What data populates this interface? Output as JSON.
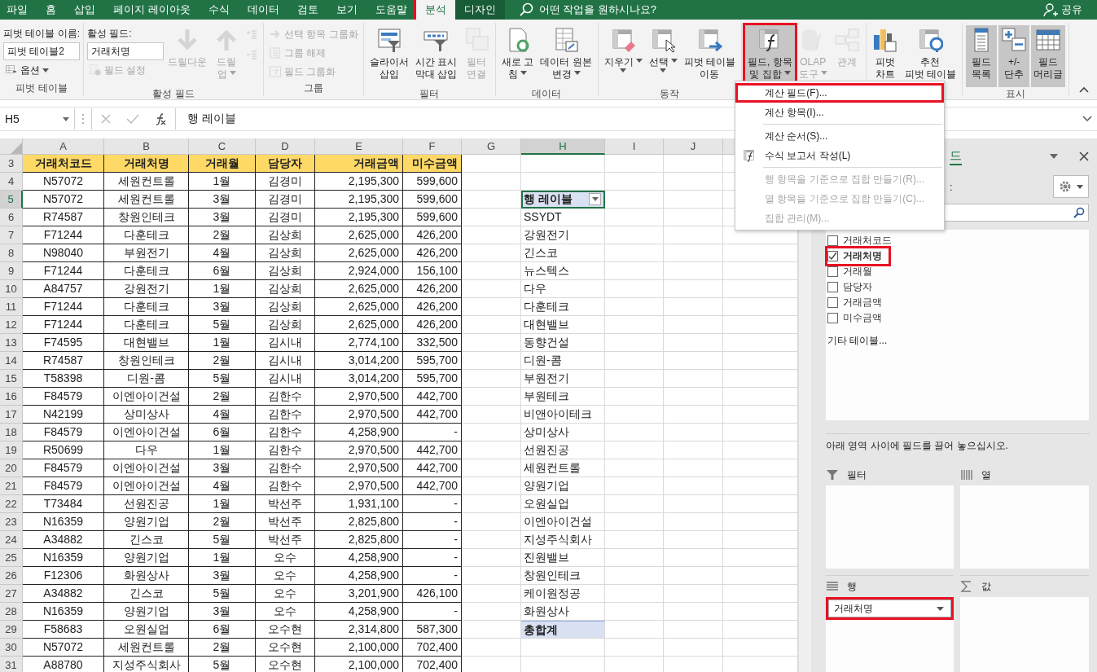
{
  "menu_tabs": [
    {
      "label": "파일",
      "selected": false,
      "kind": "normal",
      "highlighted": false
    },
    {
      "label": "홈",
      "selected": false,
      "kind": "normal",
      "highlighted": false
    },
    {
      "label": "삽입",
      "selected": false,
      "kind": "normal",
      "highlighted": false
    },
    {
      "label": "페이지 레이아웃",
      "selected": false,
      "kind": "normal",
      "highlighted": false
    },
    {
      "label": "수식",
      "selected": false,
      "kind": "normal",
      "highlighted": false
    },
    {
      "label": "데이터",
      "selected": false,
      "kind": "normal",
      "highlighted": false
    },
    {
      "label": "검토",
      "selected": false,
      "kind": "normal",
      "highlighted": false
    },
    {
      "label": "보기",
      "selected": false,
      "kind": "normal",
      "highlighted": false
    },
    {
      "label": "도움말",
      "selected": false,
      "kind": "normal",
      "highlighted": false
    },
    {
      "label": "분석",
      "selected": true,
      "kind": "contextual",
      "highlighted": true
    },
    {
      "label": "디자인",
      "selected": false,
      "kind": "contextual",
      "highlighted": false
    }
  ],
  "search": {
    "placeholder": "어떤 작업을 원하시나요?"
  },
  "share": "공유",
  "ribbon": {
    "groups": [
      {
        "label": "피벗 테이블",
        "columns": [
          [
            {
              "kind": "label",
              "text": "피벗 테이블 이름:"
            },
            {
              "kind": "field",
              "value": "피벗 테이블2"
            },
            {
              "kind": "small",
              "text": "옵션",
              "disabled": false,
              "has_menu": true
            }
          ]
        ]
      },
      {
        "label": "활성 필드",
        "columns": [
          [
            {
              "kind": "label",
              "text": "활성 필드:"
            },
            {
              "kind": "field",
              "value": "거래처명"
            },
            {
              "kind": "small",
              "text": "필드 설정",
              "disabled": true,
              "has_menu": false
            }
          ],
          [
            {
              "kind": "large",
              "lines": [
                "드릴다운"
              ],
              "disabled": true,
              "has_menu": false,
              "pressed": false,
              "highlighted": false
            }
          ],
          [
            {
              "kind": "large",
              "lines": [
                "드릴",
                "업"
              ],
              "disabled": true,
              "has_menu": true,
              "pressed": false,
              "highlighted": false
            }
          ],
          [
            {
              "kind": "icon",
              "disabled": true
            },
            {
              "kind": "icon",
              "disabled": true
            }
          ]
        ]
      },
      {
        "label": "그룹",
        "columns": [
          [
            {
              "kind": "small",
              "text": "선택 항목 그룹화",
              "disabled": true,
              "has_menu": false
            },
            {
              "kind": "small",
              "text": "그룹 해제",
              "disabled": true,
              "has_menu": false
            },
            {
              "kind": "small",
              "text": "필드 그룹화",
              "disabled": true,
              "has_menu": false
            }
          ]
        ]
      },
      {
        "label": "필터",
        "columns": [
          [
            {
              "kind": "large",
              "lines": [
                "슬라이서",
                "삽입"
              ],
              "disabled": false,
              "has_menu": false,
              "pressed": false,
              "highlighted": false
            }
          ],
          [
            {
              "kind": "large",
              "lines": [
                "시간 표시",
                "막대 삽입"
              ],
              "disabled": false,
              "has_menu": false,
              "pressed": false,
              "highlighted": false
            }
          ],
          [
            {
              "kind": "large",
              "lines": [
                "필터",
                "연결"
              ],
              "disabled": true,
              "has_menu": false,
              "pressed": false,
              "highlighted": false
            }
          ]
        ]
      },
      {
        "label": "데이터",
        "columns": [
          [
            {
              "kind": "large",
              "lines": [
                "새로 고",
                "침"
              ],
              "disabled": false,
              "has_menu": true,
              "pressed": false,
              "highlighted": false
            }
          ],
          [
            {
              "kind": "large",
              "lines": [
                "데이터 원본",
                "변경"
              ],
              "disabled": false,
              "has_menu": true,
              "pressed": false,
              "highlighted": false
            }
          ]
        ]
      },
      {
        "label": "동작",
        "columns": [
          [
            {
              "kind": "large",
              "lines": [
                "지우기"
              ],
              "disabled": false,
              "has_menu": true,
              "pressed": false,
              "highlighted": false
            }
          ],
          [
            {
              "kind": "large",
              "lines": [
                "선택"
              ],
              "disabled": false,
              "has_menu": true,
              "pressed": false,
              "highlighted": false
            }
          ],
          [
            {
              "kind": "large",
              "lines": [
                "피벗 테이블",
                "이동"
              ],
              "disabled": false,
              "has_menu": false,
              "pressed": false,
              "highlighted": false
            }
          ]
        ]
      },
      {
        "columns": [
          [
            {
              "kind": "large",
              "lines": [
                "필드, 항목",
                "및 집합"
              ],
              "disabled": false,
              "has_menu": true,
              "pressed": true,
              "highlighted": true
            }
          ],
          [
            {
              "kind": "large",
              "lines": [
                "OLAP",
                "도구"
              ],
              "disabled": true,
              "has_menu": true,
              "pressed": false,
              "highlighted": false
            }
          ],
          [
            {
              "kind": "large",
              "lines": [
                "관계"
              ],
              "disabled": true,
              "has_menu": false,
              "pressed": false,
              "highlighted": false
            }
          ]
        ]
      },
      {
        "columns": [
          [
            {
              "kind": "large",
              "lines": [
                "피벗",
                "차트"
              ],
              "disabled": false,
              "has_menu": false,
              "pressed": false,
              "highlighted": false
            }
          ],
          [
            {
              "kind": "large",
              "lines": [
                "추천",
                "피벗 테이블"
              ],
              "disabled": false,
              "has_menu": false,
              "pressed": false,
              "highlighted": false
            }
          ]
        ]
      },
      {
        "label": "표시",
        "columns": [
          [
            {
              "kind": "large",
              "lines": [
                "필드",
                "목록"
              ],
              "disabled": false,
              "has_menu": false,
              "pressed": true,
              "highlighted": false
            }
          ],
          [
            {
              "kind": "large",
              "lines": [
                "+/-",
                "단추"
              ],
              "disabled": false,
              "has_menu": false,
              "pressed": true,
              "highlighted": false
            }
          ],
          [
            {
              "kind": "large",
              "lines": [
                "필드",
                "머리글"
              ],
              "disabled": false,
              "has_menu": false,
              "pressed": true,
              "highlighted": false
            }
          ]
        ]
      }
    ]
  },
  "dropdown_menu": [
    {
      "kind": "item",
      "label": "계산 필드(F)...",
      "disabled": false,
      "has_icon": false,
      "highlighted": true
    },
    {
      "kind": "item",
      "label": "계산 항목(I)...",
      "disabled": false,
      "has_icon": false,
      "highlighted": false
    },
    {
      "kind": "separator"
    },
    {
      "kind": "item",
      "label": "계산 순서(S)...",
      "disabled": false,
      "has_icon": false,
      "highlighted": false
    },
    {
      "kind": "item",
      "label": "수식 보고서 작성(L)",
      "disabled": false,
      "has_icon": true,
      "highlighted": false
    },
    {
      "kind": "separator"
    },
    {
      "kind": "item",
      "label": "행 항목을 기준으로 집합 만들기(R)...",
      "disabled": true,
      "has_icon": false,
      "highlighted": false
    },
    {
      "kind": "item",
      "label": "열 항목을 기준으로 집합 만들기(C)...",
      "disabled": true,
      "has_icon": false,
      "highlighted": false
    },
    {
      "kind": "item",
      "label": "집합 관리(M)...",
      "disabled": true,
      "has_icon": false,
      "highlighted": false
    }
  ],
  "formula_bar": {
    "name_box": "H5",
    "formula": "행 레이블"
  },
  "sheet": {
    "columns": [
      {
        "label": "A",
        "selected": false
      },
      {
        "label": "B",
        "selected": false
      },
      {
        "label": "C",
        "selected": false
      },
      {
        "label": "D",
        "selected": false
      },
      {
        "label": "E",
        "selected": false
      },
      {
        "label": "F",
        "selected": false
      },
      {
        "label": "G",
        "selected": false
      },
      {
        "label": "H",
        "selected": true
      },
      {
        "label": "I",
        "selected": false
      },
      {
        "label": "J",
        "selected": false
      }
    ],
    "rows": [
      {
        "number": "3",
        "selected": false,
        "kind": "header",
        "cells": [
          "거래처코드",
          "거래처명",
          "거래월",
          "담당자",
          "거래금액",
          "미수금액"
        ]
      },
      {
        "number": "4",
        "selected": false,
        "kind": "data",
        "cells": [
          "N57072",
          "세원컨트롤",
          "1월",
          "김경미",
          "2,195,300",
          "599,600"
        ]
      },
      {
        "number": "5",
        "selected": true,
        "kind": "data",
        "cells": [
          "N57072",
          "세원컨트롤",
          "3월",
          "김경미",
          "2,195,300",
          "599,600"
        ],
        "pivot": {
          "kind": "header",
          "text": "행 레이블",
          "selected": true
        }
      },
      {
        "number": "6",
        "selected": false,
        "kind": "data",
        "cells": [
          "R74587",
          "창원인테크",
          "3월",
          "김경미",
          "2,195,300",
          "599,600"
        ],
        "pivot": {
          "kind": "item",
          "text": "SSYDT",
          "selected": false
        }
      },
      {
        "number": "7",
        "selected": false,
        "kind": "data",
        "cells": [
          "F71244",
          "다훈테크",
          "2월",
          "김상희",
          "2,625,000",
          "426,200"
        ],
        "pivot": {
          "kind": "item",
          "text": "강원전기",
          "selected": false
        }
      },
      {
        "number": "8",
        "selected": false,
        "kind": "data",
        "cells": [
          "N98040",
          "부원전기",
          "4월",
          "김상희",
          "2,625,000",
          "426,200"
        ],
        "pivot": {
          "kind": "item",
          "text": "긴스코",
          "selected": false
        }
      },
      {
        "number": "9",
        "selected": false,
        "kind": "data",
        "cells": [
          "F71244",
          "다훈테크",
          "6월",
          "김상희",
          "2,924,000",
          "156,100"
        ],
        "pivot": {
          "kind": "item",
          "text": "뉴스텍스",
          "selected": false
        }
      },
      {
        "number": "10",
        "selected": false,
        "kind": "data",
        "cells": [
          "A84757",
          "강원전기",
          "1월",
          "김상희",
          "2,625,000",
          "426,200"
        ],
        "pivot": {
          "kind": "item",
          "text": "다우",
          "selected": false
        }
      },
      {
        "number": "11",
        "selected": false,
        "kind": "data",
        "cells": [
          "F71244",
          "다훈테크",
          "3월",
          "김상희",
          "2,625,000",
          "426,200"
        ],
        "pivot": {
          "kind": "item",
          "text": "다훈테크",
          "selected": false
        }
      },
      {
        "number": "12",
        "selected": false,
        "kind": "data",
        "cells": [
          "F71244",
          "다훈테크",
          "5월",
          "김상희",
          "2,625,000",
          "426,200"
        ],
        "pivot": {
          "kind": "item",
          "text": "대현밸브",
          "selected": false
        }
      },
      {
        "number": "13",
        "selected": false,
        "kind": "data",
        "cells": [
          "F74595",
          "대현밸브",
          "1월",
          "김시내",
          "2,774,100",
          "332,500"
        ],
        "pivot": {
          "kind": "item",
          "text": "동향건설",
          "selected": false
        }
      },
      {
        "number": "14",
        "selected": false,
        "kind": "data",
        "cells": [
          "R74587",
          "창원인테크",
          "2월",
          "김시내",
          "3,014,200",
          "595,700"
        ],
        "pivot": {
          "kind": "item",
          "text": "디원-콤",
          "selected": false
        }
      },
      {
        "number": "15",
        "selected": false,
        "kind": "data",
        "cells": [
          "T58398",
          "디원-콤",
          "5월",
          "김시내",
          "3,014,200",
          "595,700"
        ],
        "pivot": {
          "kind": "item",
          "text": "부원전기",
          "selected": false
        }
      },
      {
        "number": "16",
        "selected": false,
        "kind": "data",
        "cells": [
          "F84579",
          "이엔아이건설",
          "2월",
          "김한수",
          "2,970,500",
          "442,700"
        ],
        "pivot": {
          "kind": "item",
          "text": "부원테크",
          "selected": false
        }
      },
      {
        "number": "17",
        "selected": false,
        "kind": "data",
        "cells": [
          "N42199",
          "상미상사",
          "4월",
          "김한수",
          "2,970,500",
          "442,700"
        ],
        "pivot": {
          "kind": "item",
          "text": "비앤아이테크",
          "selected": false
        }
      },
      {
        "number": "18",
        "selected": false,
        "kind": "data",
        "cells": [
          "F84579",
          "이엔아이건설",
          "6월",
          "김한수",
          "4,258,900",
          "-"
        ],
        "pivot": {
          "kind": "item",
          "text": "상미상사",
          "selected": false
        }
      },
      {
        "number": "19",
        "selected": false,
        "kind": "data",
        "cells": [
          "R50699",
          "다우",
          "1월",
          "김한수",
          "2,970,500",
          "442,700"
        ],
        "pivot": {
          "kind": "item",
          "text": "선원진공",
          "selected": false
        }
      },
      {
        "number": "20",
        "selected": false,
        "kind": "data",
        "cells": [
          "F84579",
          "이엔아이건설",
          "3월",
          "김한수",
          "2,970,500",
          "442,700"
        ],
        "pivot": {
          "kind": "item",
          "text": "세원컨트롤",
          "selected": false
        }
      },
      {
        "number": "21",
        "selected": false,
        "kind": "data",
        "cells": [
          "F84579",
          "이엔아이건설",
          "4월",
          "김한수",
          "2,970,500",
          "442,700"
        ],
        "pivot": {
          "kind": "item",
          "text": "양원기업",
          "selected": false
        }
      },
      {
        "number": "22",
        "selected": false,
        "kind": "data",
        "cells": [
          "T73484",
          "선원진공",
          "1월",
          "박선주",
          "1,931,100",
          "-"
        ],
        "pivot": {
          "kind": "item",
          "text": "오원실업",
          "selected": false
        }
      },
      {
        "number": "23",
        "selected": false,
        "kind": "data",
        "cells": [
          "N16359",
          "양원기업",
          "2월",
          "박선주",
          "2,825,800",
          "-"
        ],
        "pivot": {
          "kind": "item",
          "text": "이엔아이건설",
          "selected": false
        }
      },
      {
        "number": "24",
        "selected": false,
        "kind": "data",
        "cells": [
          "A34882",
          "긴스코",
          "5월",
          "박선주",
          "2,825,800",
          "-"
        ],
        "pivot": {
          "kind": "item",
          "text": "지성주식회사",
          "selected": false
        }
      },
      {
        "number": "25",
        "selected": false,
        "kind": "data",
        "cells": [
          "N16359",
          "양원기업",
          "1월",
          "오수",
          "4,258,900",
          "-"
        ],
        "pivot": {
          "kind": "item",
          "text": "진원밸브",
          "selected": false
        }
      },
      {
        "number": "26",
        "selected": false,
        "kind": "data",
        "cells": [
          "F12306",
          "화원상사",
          "3월",
          "오수",
          "4,258,900",
          "-"
        ],
        "pivot": {
          "kind": "item",
          "text": "창원인테크",
          "selected": false
        }
      },
      {
        "number": "27",
        "selected": false,
        "kind": "data",
        "cells": [
          "A34882",
          "긴스코",
          "5월",
          "오수",
          "3,201,900",
          "426,100"
        ],
        "pivot": {
          "kind": "item",
          "text": "케이원정공",
          "selected": false
        }
      },
      {
        "number": "28",
        "selected": false,
        "kind": "data",
        "cells": [
          "N16359",
          "양원기업",
          "3월",
          "오수",
          "4,258,900",
          "-"
        ],
        "pivot": {
          "kind": "item",
          "text": "화원상사",
          "selected": false
        }
      },
      {
        "number": "29",
        "selected": false,
        "kind": "data",
        "cells": [
          "F58683",
          "오원실업",
          "6월",
          "오수현",
          "2,314,800",
          "587,300"
        ],
        "pivot": {
          "kind": "total",
          "text": "총합계",
          "selected": false
        }
      },
      {
        "number": "30",
        "selected": false,
        "kind": "data",
        "cells": [
          "N57072",
          "세원컨트롤",
          "2월",
          "오수현",
          "2,100,000",
          "702,400"
        ]
      },
      {
        "number": "31",
        "selected": false,
        "kind": "data",
        "cells": [
          "A88780",
          "지성주식회사",
          "5월",
          "오수현",
          "2,100,000",
          "702,400"
        ]
      }
    ]
  },
  "field_pane": {
    "title": "드",
    "field_select_label": ":",
    "fields": [
      {
        "label": "거래처코드",
        "checked": false,
        "highlighted": false
      },
      {
        "label": "거래처명",
        "checked": true,
        "highlighted": true
      },
      {
        "label": "거래월",
        "checked": false,
        "highlighted": false
      },
      {
        "label": "담당자",
        "checked": false,
        "highlighted": false
      },
      {
        "label": "거래금액",
        "checked": false,
        "highlighted": false
      },
      {
        "label": "미수금액",
        "checked": false,
        "highlighted": false
      }
    ],
    "more_tables": "기타 테이블...",
    "hint": "아래 영역 사이에 필드를 끌어 놓으십시오.",
    "areas": [
      {
        "kind": "filter",
        "label": "필터"
      },
      {
        "kind": "columns",
        "label": "열"
      },
      {
        "kind": "rows",
        "label": "행",
        "fields": [
          {
            "label": "거래처명",
            "highlighted": true
          }
        ]
      },
      {
        "kind": "values",
        "label": "값"
      }
    ]
  }
}
